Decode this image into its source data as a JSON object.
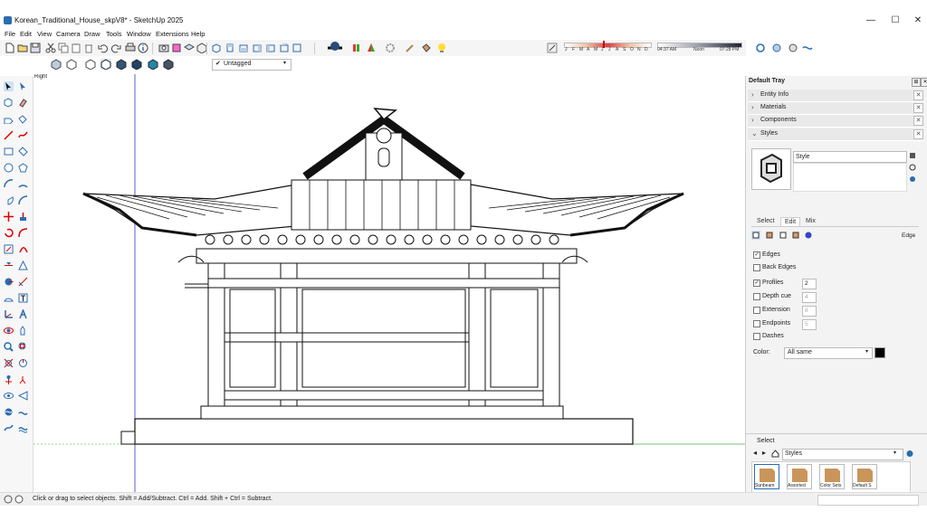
{
  "window": {
    "title": "Korean_Traditional_House_skpV8* - SketchUp 2025",
    "minimize": "—",
    "maximize": "☐",
    "close": "✕"
  },
  "menu": [
    "File",
    "Edit",
    "View",
    "Camera",
    "Draw",
    "Tools",
    "Window",
    "Extensions",
    "Help"
  ],
  "tags": {
    "selected": "Untagged"
  },
  "shadow": {
    "months": [
      "J",
      "F",
      "M",
      "A",
      "M",
      "J",
      "J",
      "A",
      "S",
      "O",
      "N",
      "D"
    ],
    "time_start": "04:37 AM",
    "time_mid": "Noon",
    "time_end": "07:28 PM"
  },
  "viewport": {
    "label": "Right"
  },
  "tray": {
    "title": "Default Tray",
    "panels": [
      {
        "label": "Entity Info"
      },
      {
        "label": "Materials"
      },
      {
        "label": "Components"
      },
      {
        "label": "Styles"
      }
    ],
    "styles": {
      "name": "Style",
      "tabs": [
        "Select",
        "Edit",
        "Mix"
      ],
      "section_label": "Edge",
      "options": [
        {
          "label": "Edges",
          "checked": true
        },
        {
          "label": "Back Edges",
          "checked": false
        },
        {
          "label": "Profiles",
          "checked": true,
          "value": "2"
        },
        {
          "label": "Depth cue",
          "checked": false,
          "value": "4"
        },
        {
          "label": "Extension",
          "checked": false,
          "value": "8"
        },
        {
          "label": "Endpoints",
          "checked": false,
          "value": "5"
        },
        {
          "label": "Dashes",
          "checked": false
        }
      ],
      "color_label": "Color:",
      "color_value": "All same",
      "select_label": "Select",
      "library": "Styles",
      "thumbs": [
        "Sunbeam",
        "Assorted",
        "Color Sets",
        "Default S"
      ]
    }
  },
  "status": {
    "message": "Click or drag to select objects. Shift = Add/Subtract. Ctrl = Add. Shift + Ctrl = Subtract."
  }
}
